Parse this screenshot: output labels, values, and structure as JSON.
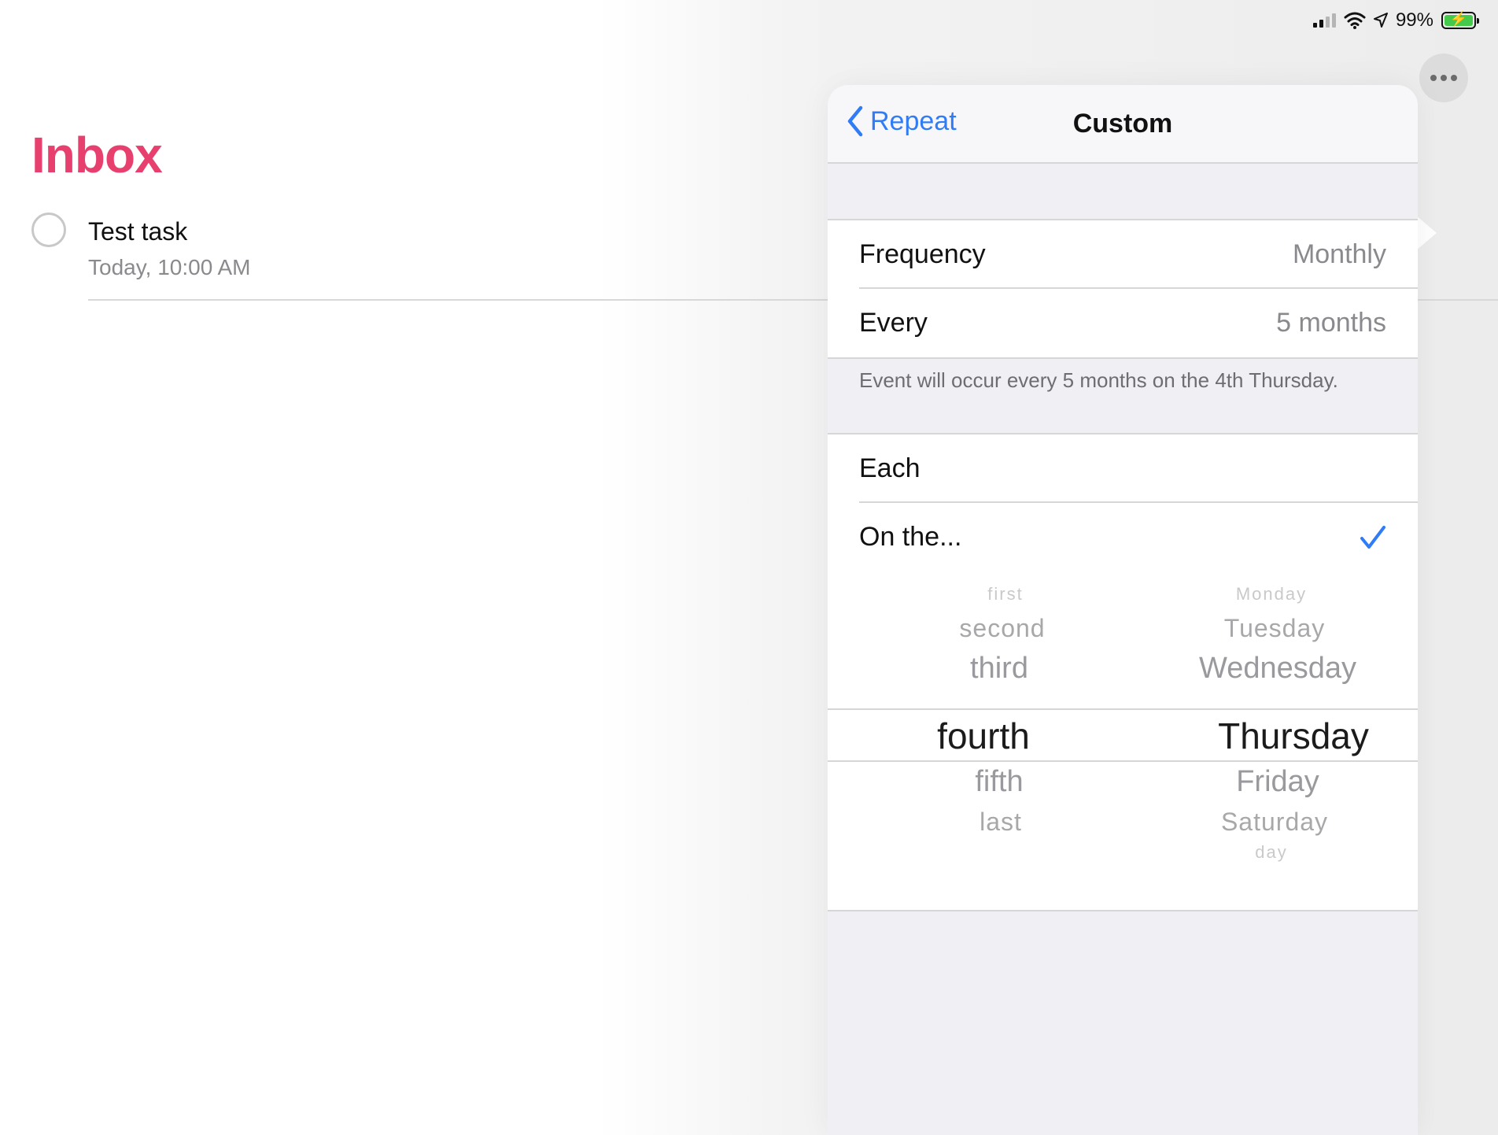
{
  "status_bar": {
    "battery_percent": "99%",
    "battery_level": 0.99,
    "icons": [
      "signal-icon",
      "wifi-icon",
      "location-icon",
      "battery-icon"
    ]
  },
  "inbox": {
    "title": "Inbox",
    "tasks": [
      {
        "title": "Test task",
        "due": "Today, 10:00 AM"
      }
    ]
  },
  "popover": {
    "nav": {
      "back_label": "Repeat",
      "title": "Custom"
    },
    "frequency": {
      "label": "Frequency",
      "value": "Monthly"
    },
    "every": {
      "label": "Every",
      "value": "5 months"
    },
    "note": "Event will occur every 5 months on the 4th Thursday.",
    "mode_options": [
      {
        "label": "Each",
        "selected": false
      },
      {
        "label": "On the...",
        "selected": true
      }
    ],
    "picker": {
      "ordinal": {
        "items": [
          "first",
          "second",
          "third",
          "fourth",
          "fifth",
          "last"
        ],
        "selected": "fourth"
      },
      "weekday": {
        "items": [
          "Monday",
          "Tuesday",
          "Wednesday",
          "Thursday",
          "Friday",
          "Saturday",
          "day"
        ],
        "selected": "Thursday"
      }
    }
  },
  "colors": {
    "accent": "#2f7cf6",
    "inbox_title": "#e8406e",
    "battery_fill": "#45c94a"
  }
}
